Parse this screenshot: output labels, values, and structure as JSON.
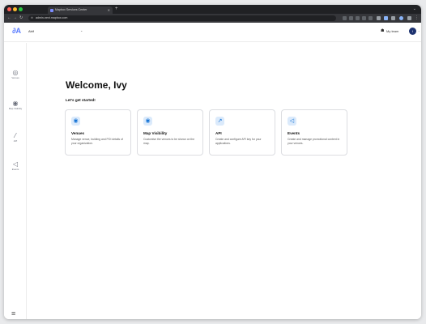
{
  "browser": {
    "tab_title": "Mapbox Services Center",
    "url": "admin-next.mapbox.com",
    "new_tab_label": "+"
  },
  "header": {
    "logo": "∂A",
    "org_name": "Abif",
    "team_label": "My team",
    "avatar_initial": "I"
  },
  "sidebar": {
    "items": [
      {
        "icon": "◎",
        "label": "Venues"
      },
      {
        "icon": "◉",
        "label": "Map Visibility"
      },
      {
        "icon": "⁄",
        "label": "API"
      },
      {
        "icon": "◁",
        "label": "Events"
      }
    ]
  },
  "main": {
    "welcome": "Welcome, Ivy",
    "subtitle": "Let's get started!",
    "cards": [
      {
        "icon": "◉",
        "title": "Venues",
        "desc": "Manage venue, building and POI details of your organization."
      },
      {
        "icon": "◉",
        "title": "Map Visibility",
        "desc": "Customise the venues to be shown on the map."
      },
      {
        "icon": "↗",
        "title": "API",
        "desc": "Create and configure API key for your applications."
      },
      {
        "icon": "◁",
        "title": "Events",
        "desc": "Create and manage promotional content in your venues."
      }
    ]
  },
  "colors": {
    "accent": "#1674d6",
    "accent_bg": "#dbeafb",
    "avatar": "#1d3270"
  }
}
